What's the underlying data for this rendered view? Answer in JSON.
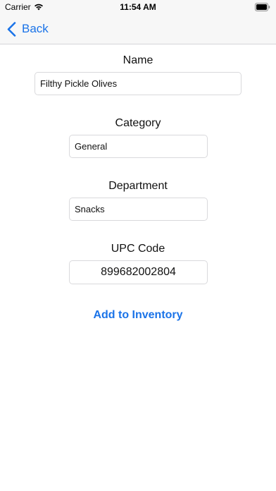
{
  "status_bar": {
    "carrier": "Carrier",
    "time": "11:54 AM"
  },
  "nav": {
    "back_label": "Back",
    "accent_color": "#1a73e8"
  },
  "form": {
    "name": {
      "label": "Name",
      "value": "Filthy Pickle Olives"
    },
    "category": {
      "label": "Category",
      "value": "General"
    },
    "department": {
      "label": "Department",
      "value": "Snacks"
    },
    "upc_code": {
      "label": "UPC Code",
      "value": "899682002804"
    },
    "add_button_label": "Add to Inventory"
  }
}
